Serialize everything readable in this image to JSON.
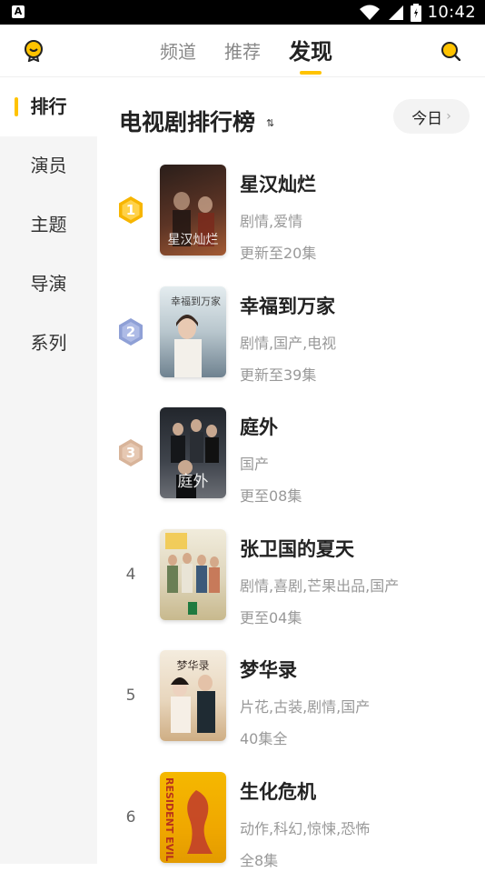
{
  "statusbar": {
    "app_badge": "A",
    "time": "10:42"
  },
  "header": {
    "tabs": [
      {
        "label": "频道"
      },
      {
        "label": "推荐"
      },
      {
        "label": "发现"
      }
    ],
    "active_tab": "发现",
    "accent": "#ffc300"
  },
  "sidebar": {
    "items": [
      {
        "label": "排行"
      },
      {
        "label": "演员"
      },
      {
        "label": "主题"
      },
      {
        "label": "导演"
      },
      {
        "label": "系列"
      }
    ],
    "active": "排行"
  },
  "main": {
    "title": "电视剧排行榜",
    "sort_icon": "⇅",
    "date_filter": "今日",
    "items": [
      {
        "rank": "1",
        "name": "星汉灿烂",
        "tags": "剧情,爱情",
        "episodes": "更新至20集",
        "poster_text": "星汉灿烂",
        "poster_colors": [
          "#3b2a24",
          "#8a4a30"
        ]
      },
      {
        "rank": "2",
        "name": "幸福到万家",
        "tags": "剧情,国产,电视",
        "episodes": "更新至39集",
        "poster_text": "幸福到万家",
        "poster_colors": [
          "#c8d2d8",
          "#7e8f9a"
        ]
      },
      {
        "rank": "3",
        "name": "庭外",
        "tags": "国产",
        "episodes": "更至08集",
        "poster_text": "庭外",
        "poster_colors": [
          "#2c3036",
          "#5a5e66"
        ]
      },
      {
        "rank": "4",
        "name": "张卫国的夏天",
        "tags": "剧情,喜剧,芒果出品,国产",
        "episodes": "更至04集",
        "poster_text": "",
        "poster_colors": [
          "#e9e6dc",
          "#c9b98a"
        ]
      },
      {
        "rank": "5",
        "name": "梦华录",
        "tags": "片花,古装,剧情,国产",
        "episodes": "40集全",
        "poster_text": "梦华录",
        "poster_colors": [
          "#efe4d2",
          "#c8a57a"
        ]
      },
      {
        "rank": "6",
        "name": "生化危机",
        "tags": "动作,科幻,惊悚,恐怖",
        "episodes": "全8集",
        "poster_text": "RESIDENT EVIL",
        "poster_colors": [
          "#f2b400",
          "#c0392b"
        ]
      }
    ]
  },
  "medal_colors": {
    "gold": "#f7b500",
    "silver": "#8fa0d6",
    "bronze": "#d8b49a"
  }
}
